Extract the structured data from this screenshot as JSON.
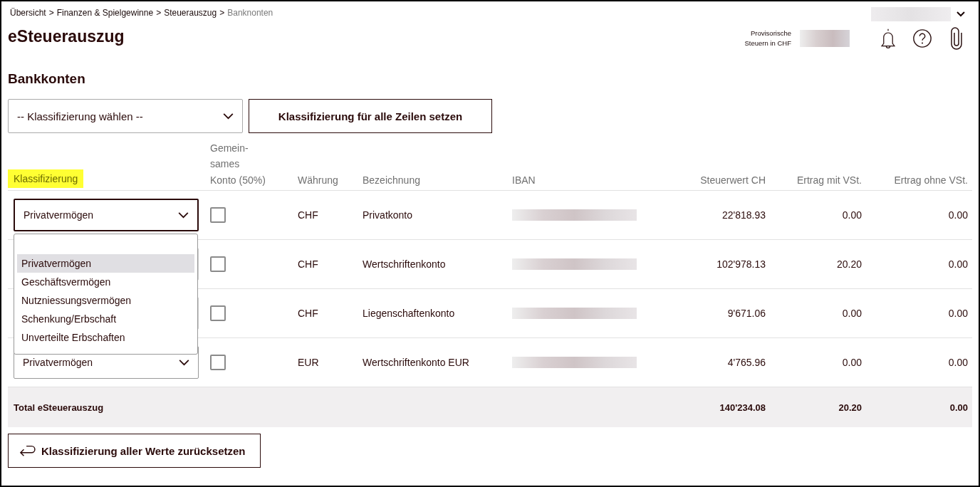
{
  "breadcrumb": {
    "separator": ">",
    "items": [
      {
        "label": "Übersicht",
        "current": false
      },
      {
        "label": "Finanzen & Spielgewinne",
        "current": false
      },
      {
        "label": "Steuerauszug",
        "current": false
      },
      {
        "label": "Banknonten",
        "current": true
      }
    ]
  },
  "title": "eSteuerauszug",
  "header_right": {
    "tax_label": "Provisorische Steuern in CHF"
  },
  "section_title": "Bankkonten",
  "bulk": {
    "select_placeholder": "-- Klassifizierung wählen --",
    "apply_button": "Klassifizierung für alle Zeilen setzen"
  },
  "table": {
    "columns": [
      {
        "label": "Klassifizierung",
        "highlighted": true
      },
      {
        "label": "Gemein-\nsames\nKonto (50%)",
        "highlighted": false
      },
      {
        "label": "Währung",
        "highlighted": false
      },
      {
        "label": "Bezeichnung",
        "highlighted": false
      },
      {
        "label": "IBAN",
        "highlighted": false
      },
      {
        "label": "Steuerwert CH",
        "highlighted": false
      },
      {
        "label": "Ertrag mit VSt.",
        "highlighted": false
      },
      {
        "label": "Ertrag ohne VSt.",
        "highlighted": false
      }
    ],
    "rows": [
      {
        "classification": "Privatvermögen",
        "focused": true,
        "joint": false,
        "currency": "CHF",
        "name": "Privatkonto",
        "tax_value": "22'818.93",
        "income_with": "0.00",
        "income_without": "0.00"
      },
      {
        "joint": false,
        "currency": "CHF",
        "name": "Wertschriftenkonto",
        "tax_value": "102'978.13",
        "income_with": "20.20",
        "income_without": "0.00"
      },
      {
        "joint": false,
        "currency": "CHF",
        "name": "Liegenschaftenkonto",
        "tax_value": "9'671.06",
        "income_with": "0.00",
        "income_without": "0.00"
      },
      {
        "classification": "Privatvermögen",
        "focused": false,
        "joint": false,
        "currency": "EUR",
        "name": "Wertschriftenkonto EUR",
        "tax_value": "4'765.96",
        "income_with": "0.00",
        "income_without": "0.00"
      }
    ],
    "total": {
      "label": "Total eSteuerauszug",
      "tax_value": "140'234.08",
      "income_with": "20.20",
      "income_without": "0.00"
    }
  },
  "dropdown": {
    "options": [
      {
        "label": "Privatvermögen",
        "selected": true
      },
      {
        "label": "Geschäftsvermögen",
        "selected": false
      },
      {
        "label": "Nutzniessungsvermögen",
        "selected": false
      },
      {
        "label": "Schenkung/Erbschaft",
        "selected": false
      },
      {
        "label": "Unverteilte Erbschaften",
        "selected": false
      }
    ]
  },
  "reset_button": "Klassifizierung aller Werte zurücksetzen"
}
